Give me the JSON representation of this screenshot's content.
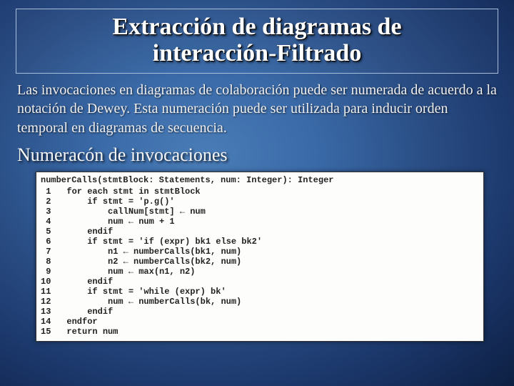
{
  "title": {
    "line1": "Extracción de diagramas de",
    "line2": "interacción-Filtrado"
  },
  "paragraph": "Las invocaciones en diagramas de colaboración puede ser numerada de acuerdo a la notación de Dewey. Esta numeración puede ser utilizada para inducir orden temporal en diagramas de secuencia.",
  "subheading": "Numeracón de invocaciones",
  "code": {
    "header": "numberCalls(stmtBlock: Statements, num: Integer): Integer",
    "lines": [
      {
        "n": "1",
        "t": "for each stmt in stmtBlock"
      },
      {
        "n": "2",
        "t": "    if stmt = 'p.g()'"
      },
      {
        "n": "3",
        "t": "        callNum[stmt] ← num"
      },
      {
        "n": "4",
        "t": "        num ← num + 1"
      },
      {
        "n": "5",
        "t": "    endif"
      },
      {
        "n": "6",
        "t": "    if stmt = 'if (expr) bk1 else bk2'"
      },
      {
        "n": "7",
        "t": "        n1 ← numberCalls(bk1, num)"
      },
      {
        "n": "8",
        "t": "        n2 ← numberCalls(bk2, num)"
      },
      {
        "n": "9",
        "t": "        num ← max(n1, n2)"
      },
      {
        "n": "10",
        "t": "    endif"
      },
      {
        "n": "11",
        "t": "    if stmt = 'while (expr) bk'"
      },
      {
        "n": "12",
        "t": "        num ← numberCalls(bk, num)"
      },
      {
        "n": "13",
        "t": "    endif"
      },
      {
        "n": "14",
        "t": "endfor"
      },
      {
        "n": "15",
        "t": "return num"
      }
    ]
  }
}
